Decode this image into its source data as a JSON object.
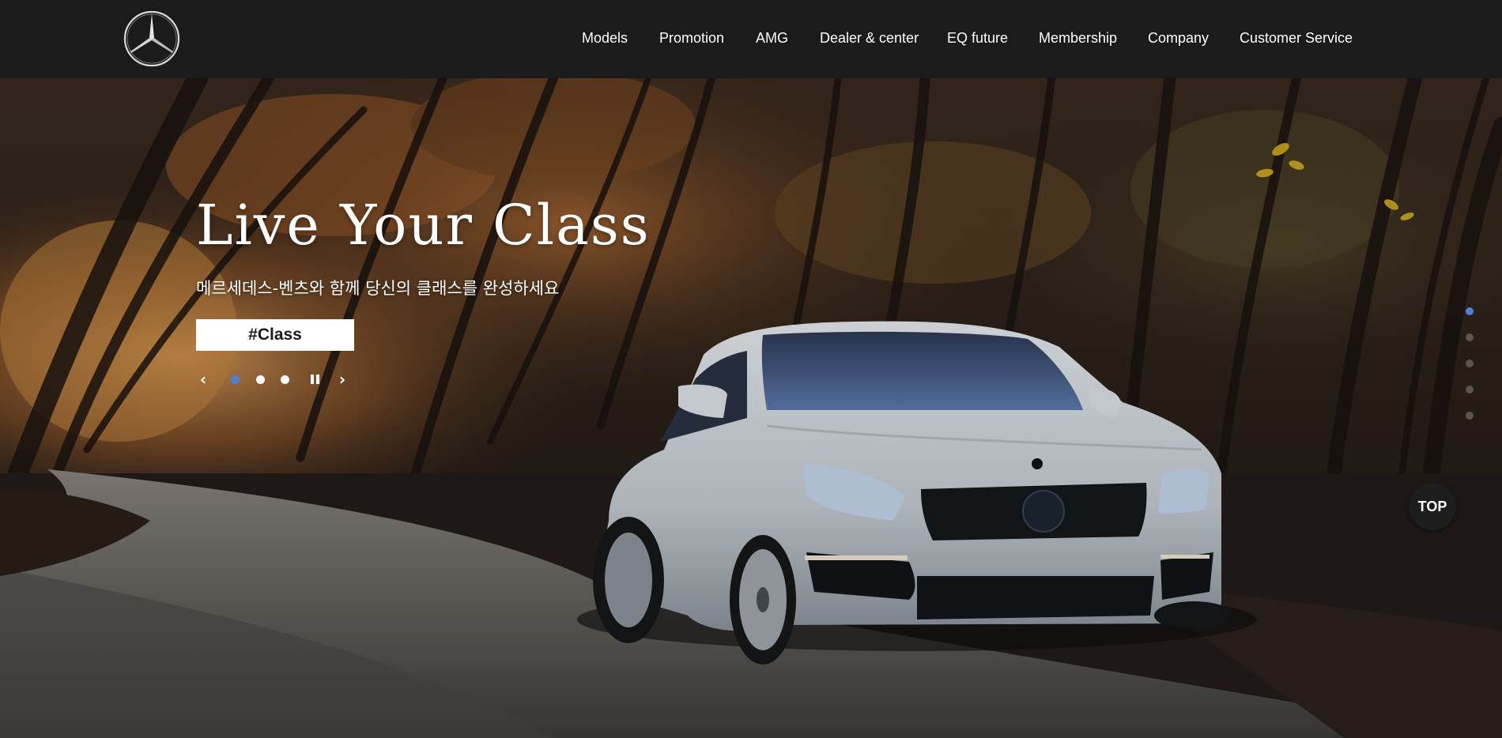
{
  "header": {
    "nav": [
      {
        "label": "Models"
      },
      {
        "label": "Promotion"
      },
      {
        "label": "AMG"
      },
      {
        "label": "Dealer & center"
      },
      {
        "label": "EQ future"
      },
      {
        "label": "Membership"
      },
      {
        "label": "Company"
      },
      {
        "label": "Customer Service"
      }
    ]
  },
  "hero": {
    "title": "Live Your Class",
    "subtitle": "메르세데스-벤츠와 함께 당신의 클래스를 완성하세요",
    "button_label": "#Class",
    "slider": {
      "prev_icon": "chevron-left-icon",
      "next_icon": "chevron-right-icon",
      "pause_icon": "pause-icon",
      "slide_count": 3,
      "active_slide": 1
    },
    "section_dots": {
      "count": 5,
      "active": 1
    }
  },
  "top_button": {
    "label": "TOP"
  },
  "colors": {
    "header_bg": "#1b1b1b",
    "accent": "#4f82d6",
    "text": "#ffffff"
  }
}
